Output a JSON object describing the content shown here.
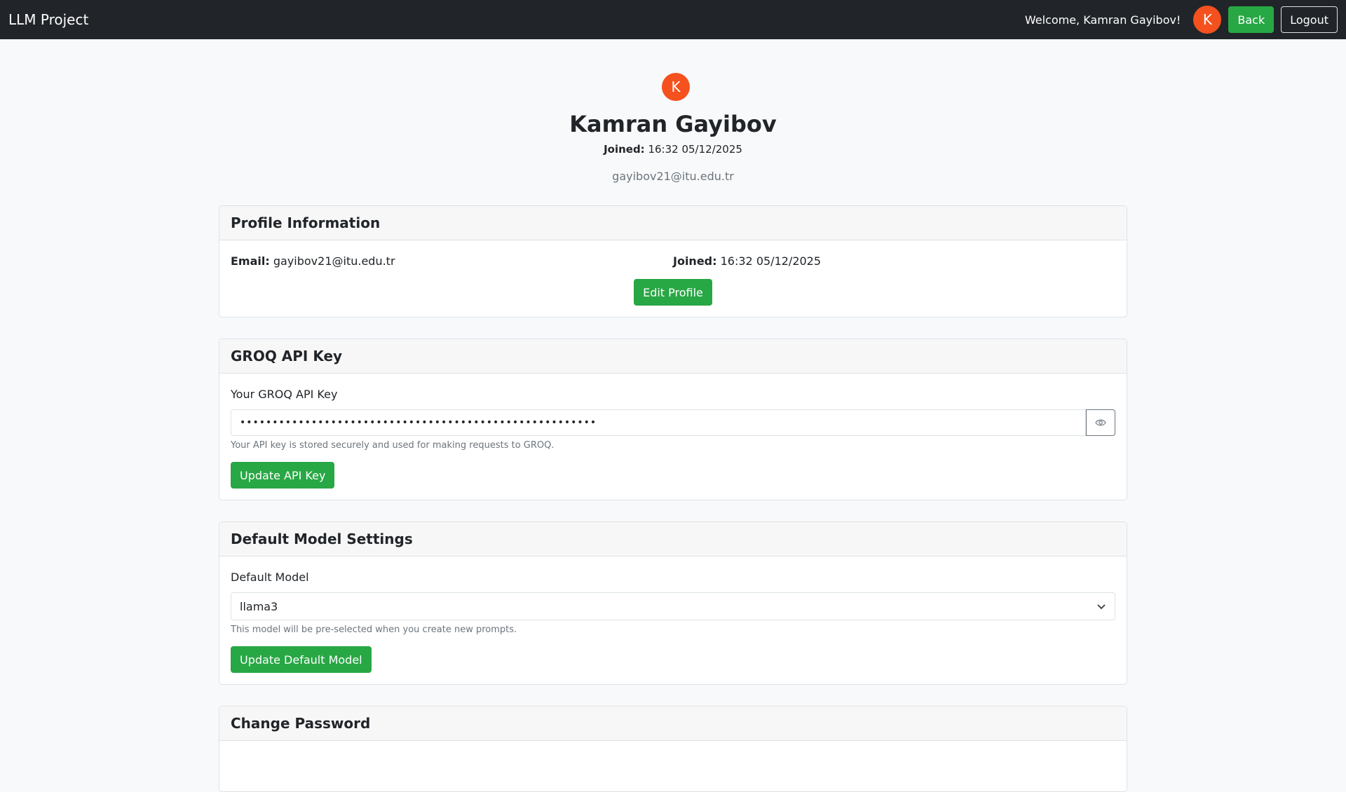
{
  "navbar": {
    "brand": "LLM Project",
    "welcome": "Welcome, Kamran Gayibov!",
    "avatar_letter": "K",
    "back_label": "Back",
    "logout_label": "Logout"
  },
  "profile": {
    "avatar_letter": "K",
    "name": "Kamran Gayibov",
    "joined_label": "Joined:",
    "joined_value": "16:32 05/12/2025",
    "email": "gayibov21@itu.edu.tr"
  },
  "profile_info": {
    "title": "Profile Information",
    "email_label": "Email:",
    "email_value": "gayibov21@itu.edu.tr",
    "joined_label": "Joined:",
    "joined_value": "16:32 05/12/2025",
    "edit_label": "Edit Profile"
  },
  "api_key": {
    "title": "GROQ API Key",
    "field_label": "Your GROQ API Key",
    "masked_value": "•••••••••••••••••••••••••••••••••••••••••••••••••••••••",
    "help": "Your API key is stored securely and used for making requests to GROQ.",
    "update_label": "Update API Key",
    "toggle_icon": "eye-icon"
  },
  "default_model": {
    "title": "Default Model Settings",
    "field_label": "Default Model",
    "selected": "llama3",
    "help": "This model will be pre-selected when you create new prompts.",
    "update_label": "Update Default Model"
  },
  "change_password": {
    "title": "Change Password"
  },
  "colors": {
    "navbar": "#212529",
    "accent_green": "#28a745",
    "avatar": "#f4511e"
  }
}
